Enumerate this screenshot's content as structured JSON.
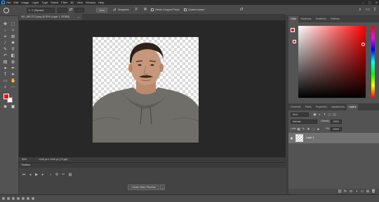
{
  "menubar": {
    "logo": "Ps",
    "items": [
      "File",
      "Edit",
      "Image",
      "Layer",
      "Type",
      "Select",
      "Filter",
      "3D",
      "View",
      "Window",
      "Help"
    ]
  },
  "options": {
    "ratio_select": "1 : 1 (Square)",
    "clear_label": "Clear",
    "straighten_label": "Straighten",
    "delete_cropped_label": "Delete Cropped Pixels",
    "content_aware_label": "Content-Aware"
  },
  "document": {
    "tab_title": "351_884.2713.png @ 50% (Layer 1, RGB/8)",
    "zoom": "50%",
    "doc_info": "1440 px x 1440 px (72 ppi)"
  },
  "timeline": {
    "title": "Timeline",
    "create_button": "Create Video Timeline"
  },
  "color_panel": {
    "tabs": [
      "Color",
      "Swatches",
      "Gradients",
      "Patterns"
    ],
    "active_tab": "Color",
    "foreground": "#e11b22"
  },
  "layers_panel": {
    "tabs": [
      "Channels",
      "Paths",
      "Properties",
      "Adjustments",
      "Layers"
    ],
    "active_tab": "Layers",
    "kind_label": "Kind",
    "blend_mode": "Normal",
    "opacity_label": "Opacity:",
    "opacity_value": "100%",
    "lock_label": "Lock:",
    "fill_label": "Fill:",
    "fill_value": "100%",
    "layers": [
      {
        "name": "Layer 1",
        "visible": true
      }
    ]
  }
}
